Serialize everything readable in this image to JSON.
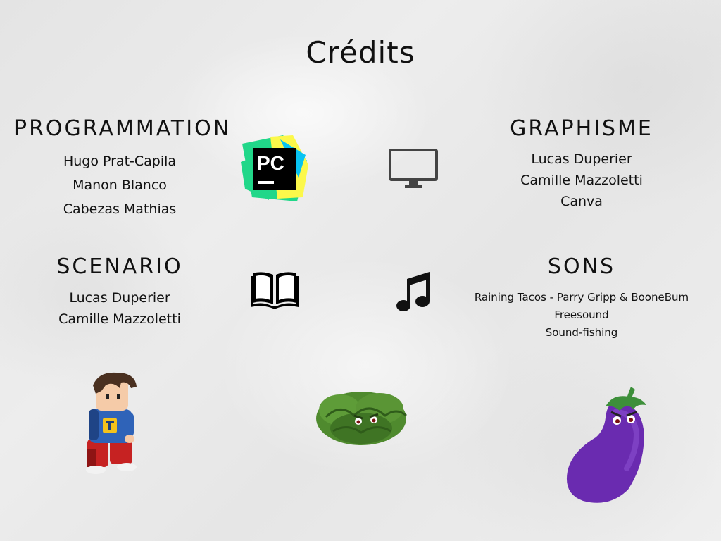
{
  "title": "Crédits",
  "sections": {
    "programmation": {
      "heading": "PROGRAMMATION",
      "names": [
        "Hugo Prat-Capila",
        "Manon Blanco",
        "Cabezas Mathias"
      ],
      "icon": "pycharm-logo"
    },
    "graphisme": {
      "heading": "GRAPHISME",
      "names": [
        "Lucas Duperier",
        "Camille Mazzoletti",
        "Canva"
      ],
      "icon": "monitor-icon"
    },
    "scenario": {
      "heading": "SCENARIO",
      "names": [
        "Lucas Duperier",
        "Camille Mazzoletti"
      ],
      "icon": "open-book-icon"
    },
    "sons": {
      "heading": "SONS",
      "names": [
        "Raining Tacos - Parry Gripp & BooneBum",
        "Freesound",
        "Sound-fishing"
      ],
      "icon": "music-note-icon"
    }
  },
  "logo_text": "PC",
  "colors": {
    "text": "#111111",
    "pycharm_green": "#21d789",
    "pycharm_yellow": "#fcf84a",
    "pycharm_blue": "#07c3f2",
    "cabbage": "#4f8a2e",
    "eggplant": "#6a2bb0"
  }
}
